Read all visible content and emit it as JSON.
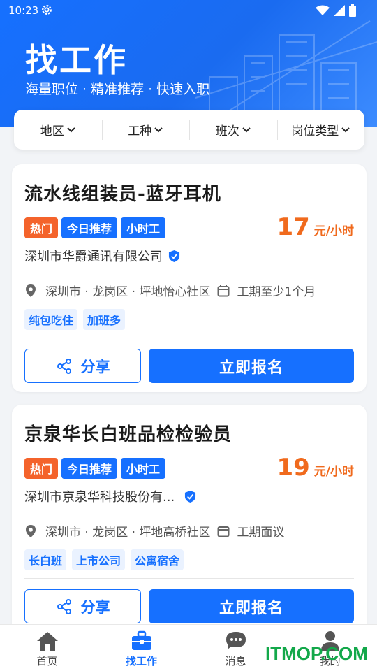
{
  "status_bar": {
    "time": "10:23"
  },
  "header": {
    "title": "找工作",
    "subtitle": "海量职位 · 精准推荐 · 快速入职"
  },
  "filters": [
    {
      "label": "地区"
    },
    {
      "label": "工种"
    },
    {
      "label": "班次"
    },
    {
      "label": "岗位类型"
    }
  ],
  "jobs": [
    {
      "title": "流水线组装员-蓝牙耳机",
      "badges": [
        "热门",
        "今日推荐",
        "小时工"
      ],
      "salary": "17",
      "salary_unit": "元/小时",
      "company": "深圳市华爵通讯有限公司",
      "location": "深圳市 · 龙岗区 · 坪地怡心社区",
      "period": "工期至少1个月",
      "tags": [
        "纯包吃住",
        "加班多"
      ],
      "share_label": "分享",
      "apply_label": "立即报名"
    },
    {
      "title": "京泉华长白班品检检验员",
      "badges": [
        "热门",
        "今日推荐",
        "小时工"
      ],
      "salary": "19",
      "salary_unit": "元/小时",
      "company": "深圳市京泉华科技股份有...",
      "location": "深圳市 · 龙岗区 · 坪地高桥社区",
      "period": "工期面议",
      "tags": [
        "长白班",
        "上市公司",
        "公寓宿舍"
      ],
      "share_label": "分享",
      "apply_label": "立即报名"
    }
  ],
  "bottom_nav": [
    {
      "label": "首页",
      "icon": "home-icon"
    },
    {
      "label": "找工作",
      "icon": "briefcase-icon",
      "active": true
    },
    {
      "label": "消息",
      "icon": "message-icon"
    },
    {
      "label": "我的",
      "icon": "person-icon"
    }
  ],
  "watermark": "ITMOP.COM",
  "colors": {
    "primary": "#1670ff",
    "hot": "#f4632b",
    "salary": "#f06a1d"
  }
}
